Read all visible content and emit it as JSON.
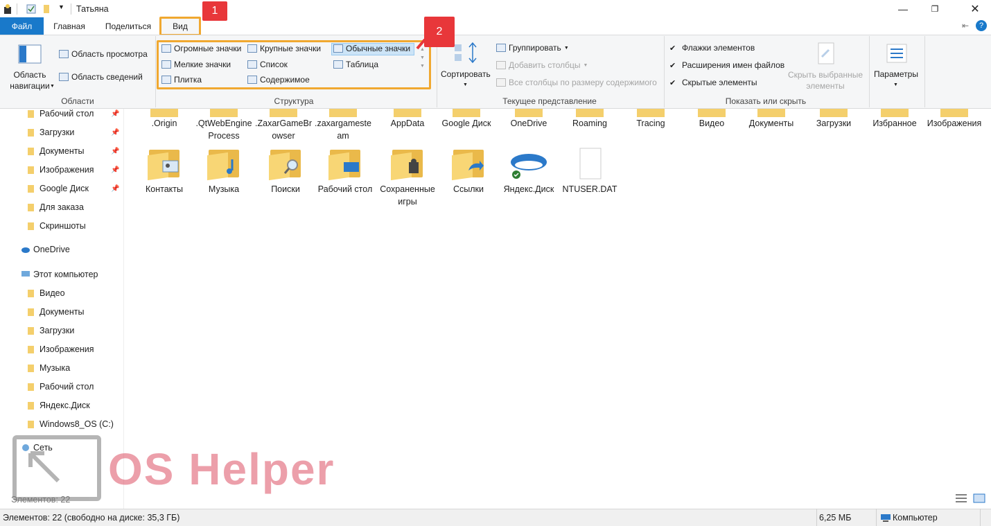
{
  "window": {
    "title": "Татьяна"
  },
  "tabs": {
    "file": "Файл",
    "home": "Главная",
    "share": "Поделиться",
    "view": "Вид"
  },
  "ribbon": {
    "areas": {
      "nav_pane": "Область навигации",
      "preview": "Область просмотра",
      "details": "Область сведений",
      "label": "Области"
    },
    "layout": {
      "huge_icons": "Огромные значки",
      "large_icons": "Крупные значки",
      "normal_icons": "Обычные значки",
      "small_icons": "Мелкие значки",
      "list": "Список",
      "table": "Таблица",
      "tiles": "Плитка",
      "content": "Содержимое",
      "label": "Структура"
    },
    "current_view": {
      "sort": "Сортировать",
      "group": "Группировать",
      "add_columns": "Добавить столбцы",
      "fit_columns": "Все столбцы по размеру содержимого",
      "label": "Текущее представление"
    },
    "show_hide": {
      "checkboxes": "Флажки элементов",
      "extensions": "Расширения имен файлов",
      "hidden": "Скрытые элементы",
      "hide_selected": "Скрыть выбранные элементы",
      "label": "Показать или скрыть"
    },
    "options": "Параметры"
  },
  "nav": {
    "quick": [
      {
        "label": "Рабочий стол"
      },
      {
        "label": "Загрузки"
      },
      {
        "label": "Документы"
      },
      {
        "label": "Изображения"
      },
      {
        "label": "Google Диск"
      },
      {
        "label": "Для заказа"
      },
      {
        "label": "Скриншоты"
      }
    ],
    "onedrive": "OneDrive",
    "this_pc": "Этот компьютер",
    "pc_items": [
      {
        "label": "Видео"
      },
      {
        "label": "Документы"
      },
      {
        "label": "Загрузки"
      },
      {
        "label": "Изображения"
      },
      {
        "label": "Музыка"
      },
      {
        "label": "Рабочий стол"
      },
      {
        "label": "Яндекс.Диск"
      },
      {
        "label": "Windows8_OS (C:)"
      }
    ],
    "network": "Сеть"
  },
  "files_row1": [
    ".Origin",
    ".QtWebEngineProcess",
    ".ZaxarGameBrowser",
    ".zaxargamesteam",
    "AppData",
    "Google Диск",
    "OneDrive",
    "Roaming",
    "Tracing",
    "Видео",
    "Документы",
    "Загрузки",
    "Избранное",
    "Изображения"
  ],
  "files_row2": [
    "Контакты",
    "Музыка",
    "Поиски",
    "Рабочий стол",
    "Сохраненные игры",
    "Ссылки",
    "Яндекс.Диск",
    "NTUSER.DAT"
  ],
  "status": {
    "items": "Элементов: 22 (свободно на диске: 35,3 ГБ)",
    "size": "6,25 МБ",
    "location": "Компьютер",
    "items_short": "Элементов: 22"
  },
  "annotations": {
    "one": "1",
    "two": "2"
  },
  "watermark": "OS Helper",
  "colors": {
    "accent": "#1979ca",
    "highlight": "#f0a830",
    "badge": "#e8373a"
  }
}
